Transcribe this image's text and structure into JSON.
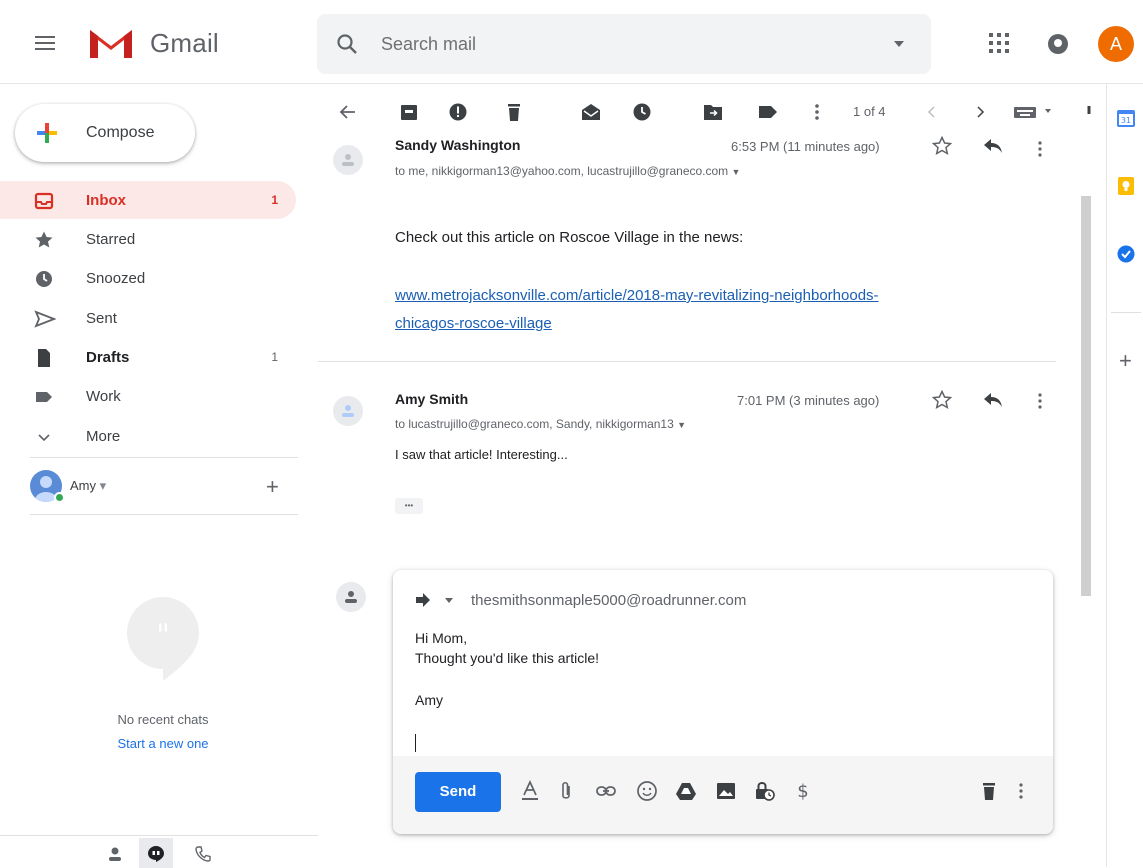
{
  "app": {
    "name": "Gmail",
    "accent": "#d93025",
    "avatar_letter": "A"
  },
  "search": {
    "placeholder": "Search mail"
  },
  "compose": {
    "label": "Compose"
  },
  "nav": [
    {
      "label": "Inbox",
      "count": "1",
      "icon": "inbox-icon"
    },
    {
      "label": "Starred",
      "count": "",
      "icon": "star-icon"
    },
    {
      "label": "Snoozed",
      "count": "",
      "icon": "clock-icon"
    },
    {
      "label": "Sent",
      "count": "",
      "icon": "send-icon"
    },
    {
      "label": "Drafts",
      "count": "1",
      "icon": "draft-icon"
    },
    {
      "label": "Work",
      "count": "",
      "icon": "label-icon"
    },
    {
      "label": "More",
      "count": "",
      "icon": "chevron-down-icon"
    }
  ],
  "hangouts": {
    "user": "Amy",
    "user_caret": "▾",
    "no_chats": "No recent chats",
    "start_new": "Start a new one"
  },
  "toolbar": {
    "pager": "1 of 4"
  },
  "messages": [
    {
      "sender": "Sandy Washington",
      "time": "6:53 PM (11 minutes ago)",
      "recipients": "to me, nikkigorman13@yahoo.com, lucastrujillo@graneco.com",
      "body": "Check out this article on Roscoe Village in the news:",
      "link_line1": "www.metrojacksonville.com/article/2018-may-revitalizing-neighborhoods-",
      "link_line2": "chicagos-roscoe-village"
    },
    {
      "sender": "Amy Smith",
      "time": "7:01 PM (3 minutes ago)",
      "recipients": "to lucastrujillo@graneco.com, Sandy, nikkigorman13",
      "body": "I saw that article! Interesting...",
      "ellipsis": "•••"
    }
  ],
  "reply": {
    "to": "thesmithsonmaple5000@roadrunner.com",
    "lines": [
      "Hi Mom,",
      "Thought you'd like this article!",
      "Amy"
    ],
    "send_label": "Send"
  },
  "colors": {
    "send_button": "#1a73e8",
    "inbox_active_bg": "#fce8e6",
    "link": "#1a5fb4",
    "avatar": "#ef6c00"
  }
}
